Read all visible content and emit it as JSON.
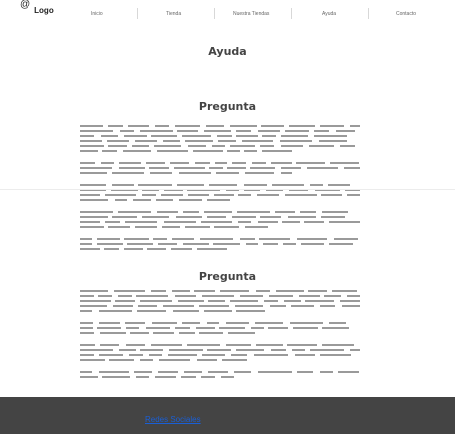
{
  "header": {
    "logo_icon": "@",
    "logo_text": "Logo",
    "nav": [
      "Inicio",
      "Tienda",
      "Nuestra Tiendas",
      "Ayuda",
      "Contacto"
    ]
  },
  "main": {
    "title": "Ayuda",
    "sections": [
      {
        "title": "Pregunta"
      },
      {
        "title": "Pregunta"
      }
    ]
  },
  "footer": {
    "link": "Redes Sociales",
    "background": "#444444"
  }
}
